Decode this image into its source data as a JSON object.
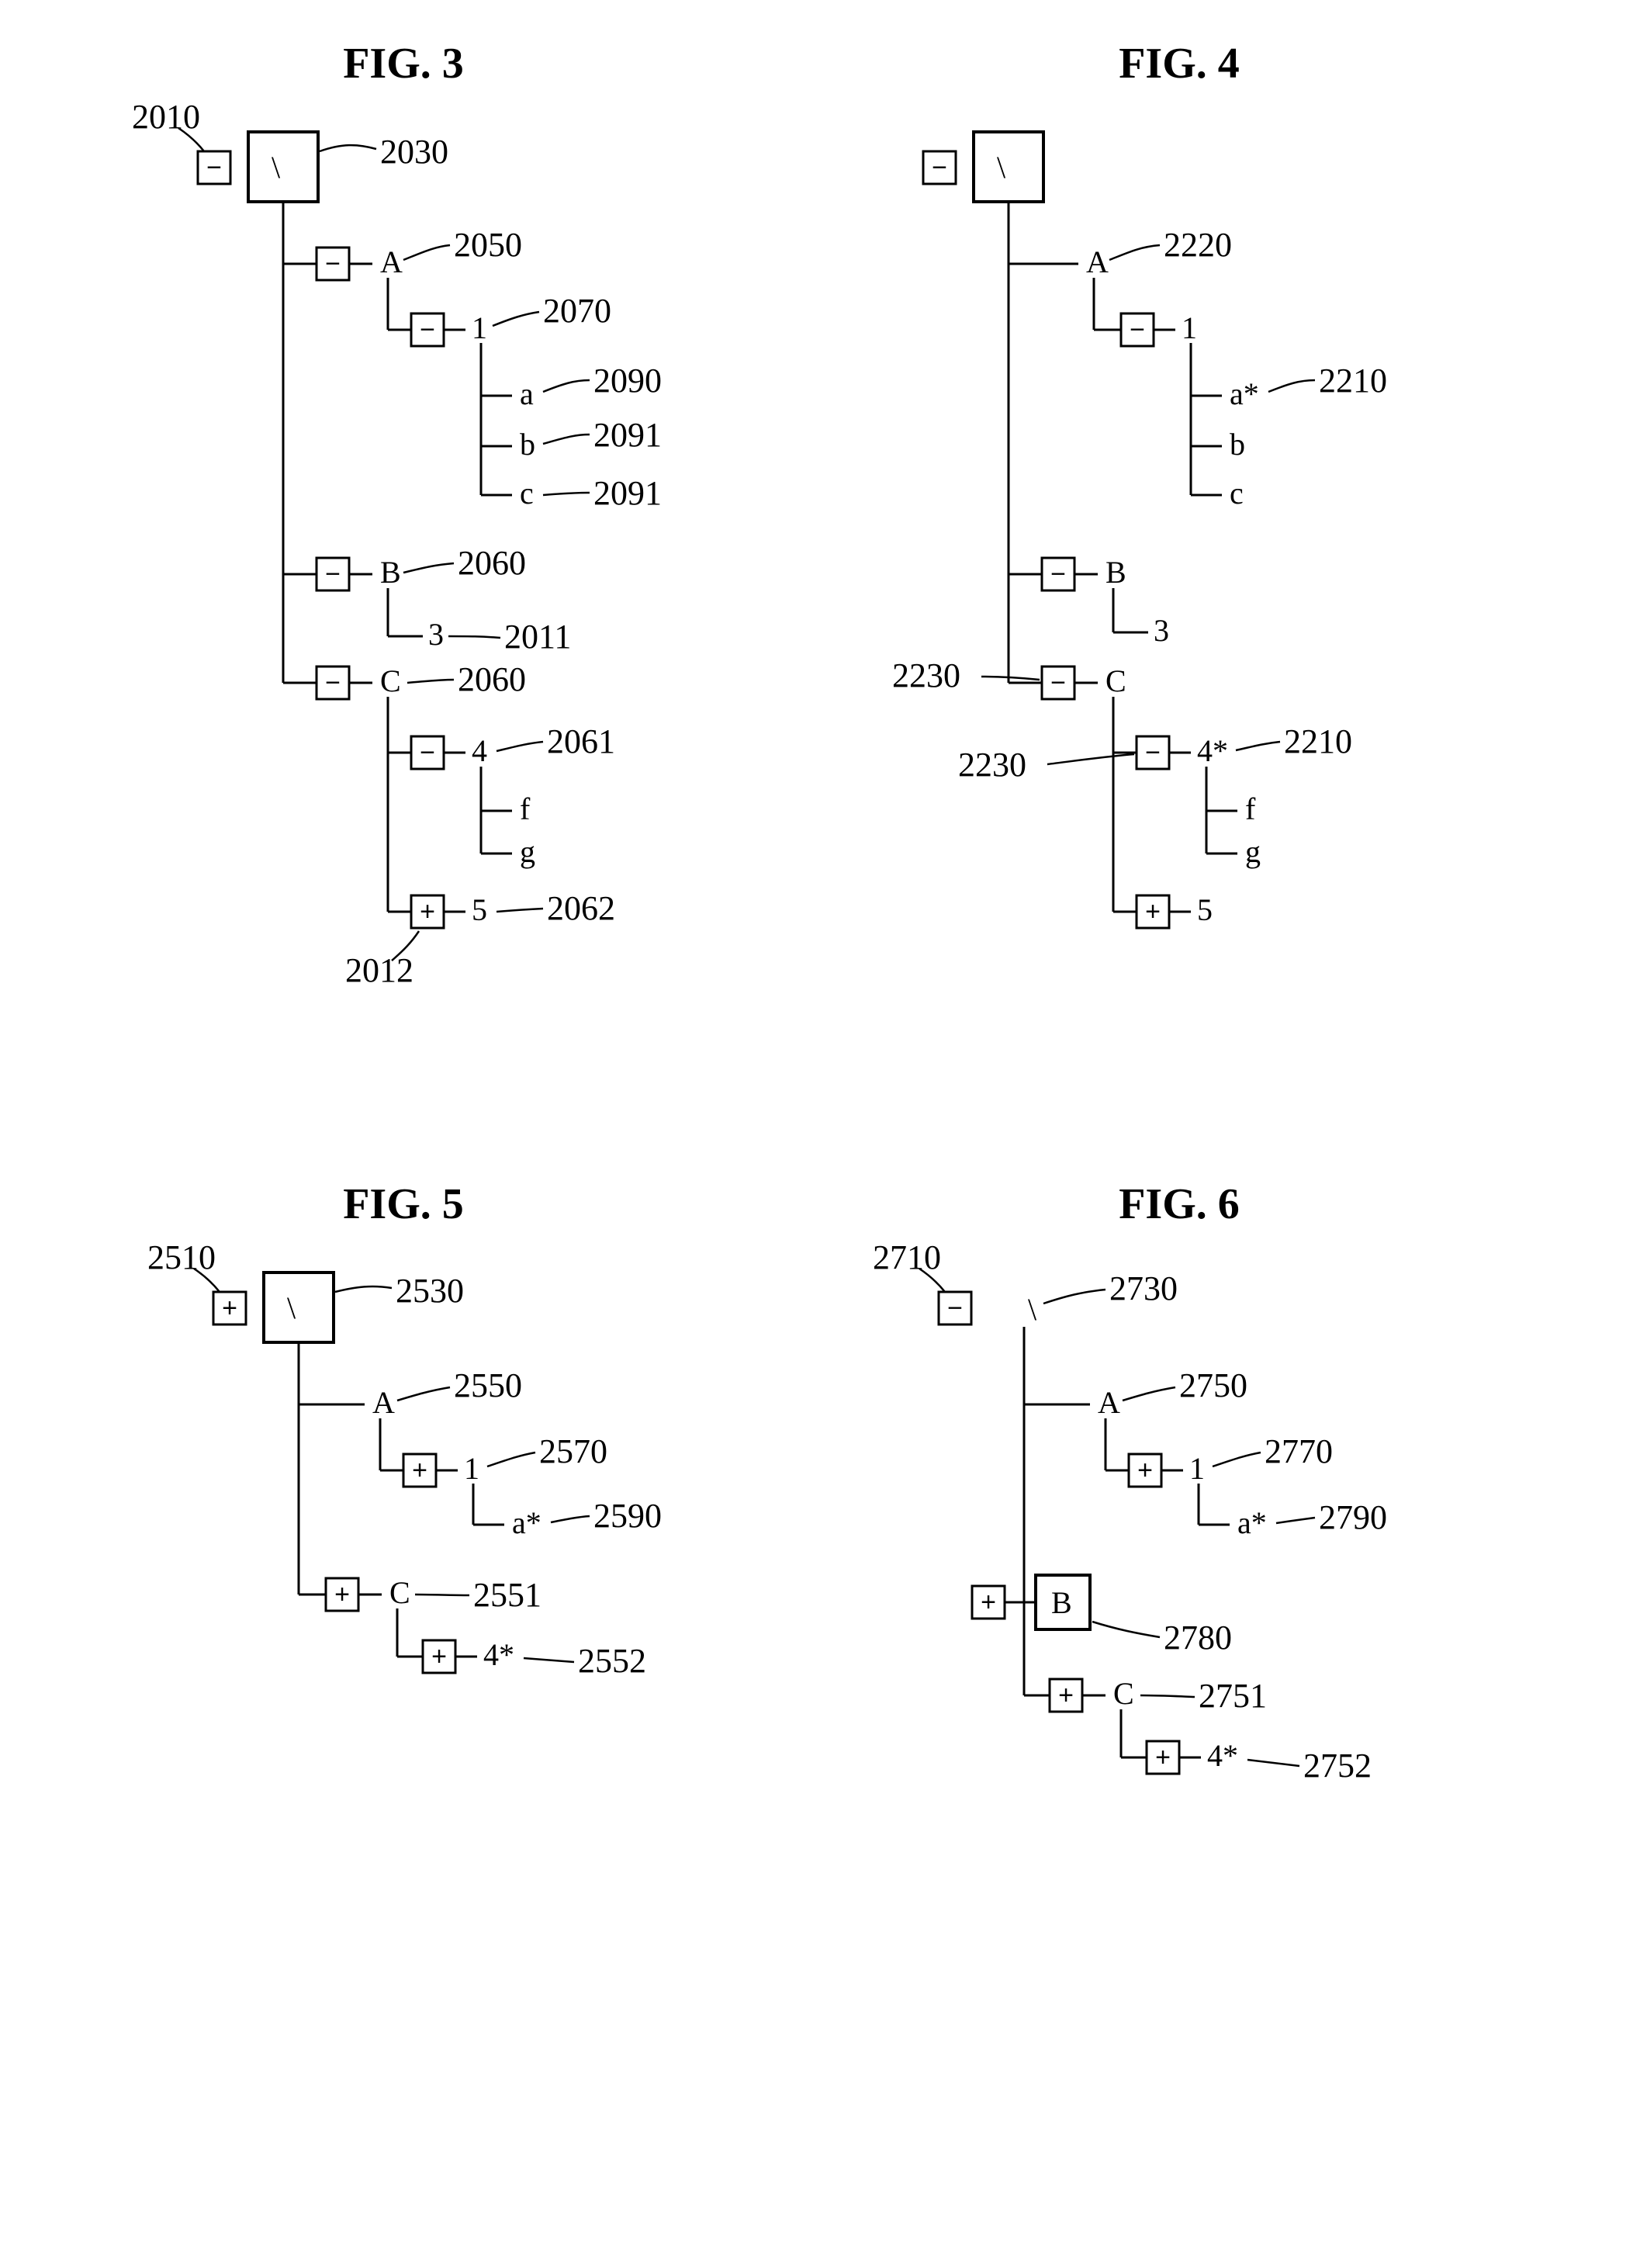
{
  "fig3": {
    "title": "FIG. 3",
    "root": "\\",
    "n_A": "A",
    "n_B": "B",
    "n_C": "C",
    "n_1": "1",
    "n_3": "3",
    "n_4": "4",
    "n_5": "5",
    "n_a": "a",
    "n_b": "b",
    "n_c": "c",
    "n_f": "f",
    "n_g": "g",
    "c2010": "2010",
    "c2030": "2030",
    "c2050": "2050",
    "c2070": "2070",
    "c2090": "2090",
    "c2091a": "2091",
    "c2091b": "2091",
    "c2060a": "2060",
    "c2060b": "2060",
    "c2011": "2011",
    "c2061": "2061",
    "c2062": "2062",
    "c2012": "2012"
  },
  "fig4": {
    "title": "FIG. 4",
    "root": "\\",
    "n_A": "A",
    "n_B": "B",
    "n_C": "C",
    "n_1": "1",
    "n_3": "3",
    "n_4": "4*",
    "n_5": "5",
    "n_a": "a*",
    "n_b": "b",
    "n_c": "c",
    "n_f": "f",
    "n_g": "g",
    "c2220": "2220",
    "c2210a": "2210",
    "c2210b": "2210",
    "c2230a": "2230",
    "c2230b": "2230"
  },
  "fig5": {
    "title": "FIG. 5",
    "root": "\\",
    "n_A": "A",
    "n_C": "C",
    "n_1": "1",
    "n_4": "4*",
    "n_a": "a*",
    "c2510": "2510",
    "c2530": "2530",
    "c2550": "2550",
    "c2570": "2570",
    "c2590": "2590",
    "c2551": "2551",
    "c2552": "2552"
  },
  "fig6": {
    "title": "FIG. 6",
    "root": "\\",
    "n_A": "A",
    "n_B": "B",
    "n_C": "C",
    "n_1": "1",
    "n_4": "4*",
    "n_a": "a*",
    "c2710": "2710",
    "c2730": "2730",
    "c2750": "2750",
    "c2770": "2770",
    "c2790": "2790",
    "c2780": "2780",
    "c2751": "2751",
    "c2752": "2752"
  }
}
